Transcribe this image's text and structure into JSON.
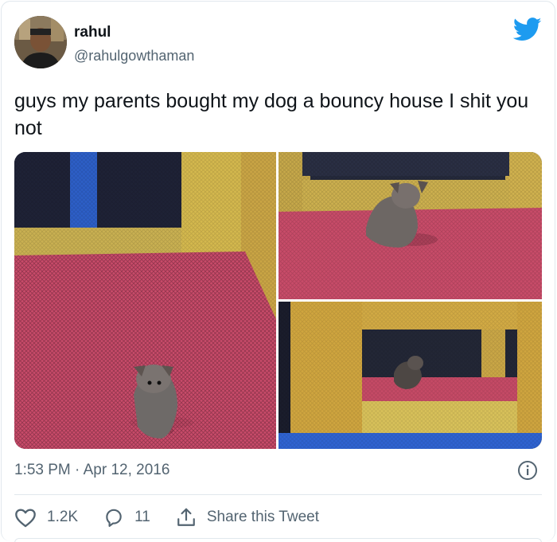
{
  "author": {
    "name": "rahul",
    "handle": "@rahulgowthaman"
  },
  "tweet": {
    "text": "guys my parents bought my dog a bouncy house I shit you not"
  },
  "meta": {
    "timestamp": "1:53 PM · Apr 12, 2016"
  },
  "actions": {
    "likes": "1.2K",
    "replies": "11",
    "share_label": "Share this Tweet"
  },
  "colors": {
    "twitter_blue": "#1d9bf0",
    "secondary_text": "#536471",
    "border": "#e1e8ed"
  },
  "icons": [
    "twitter-bird-icon",
    "info-icon",
    "heart-icon",
    "reply-icon",
    "share-icon"
  ]
}
